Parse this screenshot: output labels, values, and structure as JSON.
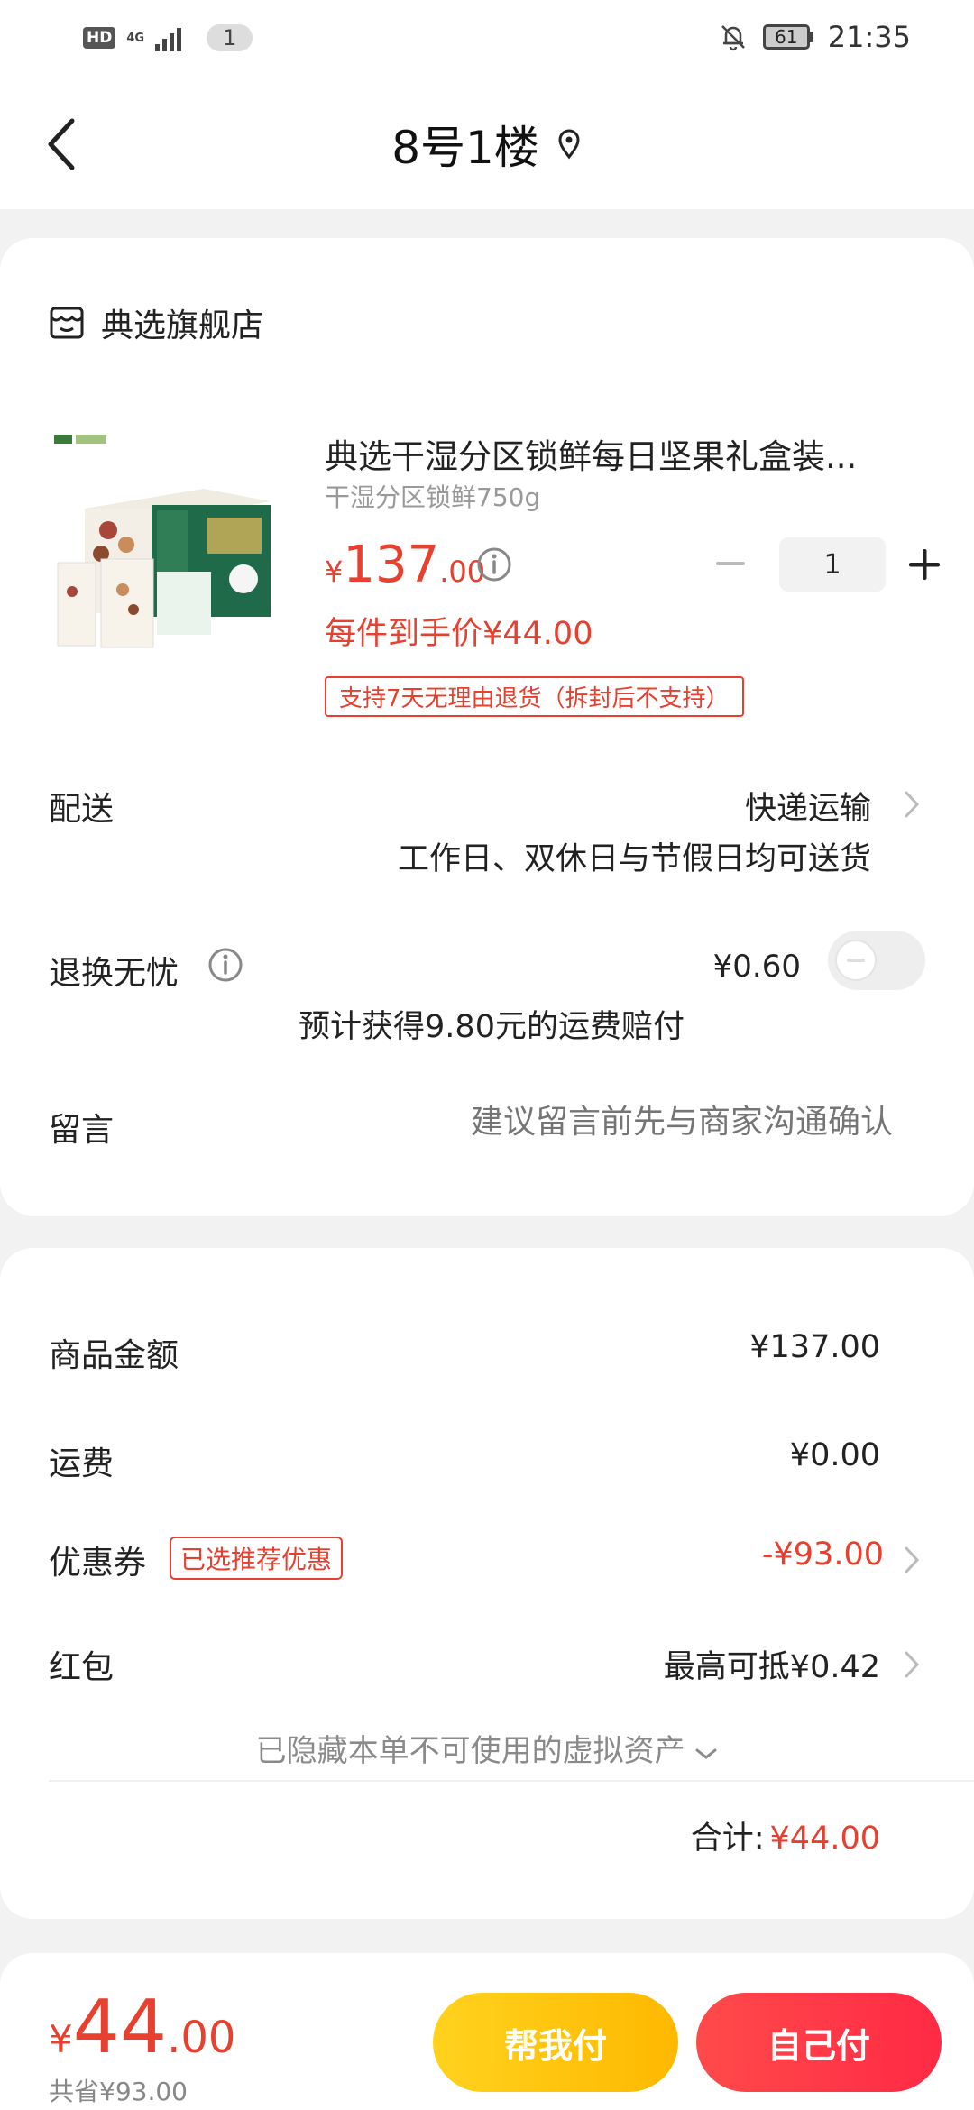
{
  "status_bar": {
    "hd": "HD",
    "network": "4G",
    "notification_count": "1",
    "battery": "61",
    "time": "21:35"
  },
  "header": {
    "title": "8号1楼"
  },
  "store": {
    "name": "典选旗舰店"
  },
  "product": {
    "title": "典选干湿分区锁鲜每日坚果礼盒装...",
    "spec": "干湿分区锁鲜750g",
    "price_symbol": "¥",
    "price_int": "137",
    "price_dec": ".00",
    "quantity": "1",
    "unit_price": "每件到手价¥44.00",
    "return_policy": "支持7天无理由退货（拆封后不支持）"
  },
  "delivery": {
    "label": "配送",
    "value": "快递运输",
    "note": "工作日、双休日与节假日均可送货"
  },
  "exchange": {
    "label": "退换无忧",
    "price": "¥0.60",
    "enabled": false,
    "note": "预计获得9.80元的运费赔付"
  },
  "remark": {
    "label": "留言",
    "placeholder": "建议留言前先与商家沟通确认"
  },
  "summary": {
    "goods_label": "商品金额",
    "goods_value": "¥137.00",
    "shipping_label": "运费",
    "shipping_value": "¥0.00",
    "coupon_label": "优惠券",
    "coupon_tag": "已选推荐优惠",
    "coupon_value": "-¥93.00",
    "redpacket_label": "红包",
    "redpacket_value": "最高可抵¥0.42",
    "hidden_assets": "已隐藏本单不可使用的虚拟资产",
    "total_label": "合计:",
    "total_value": "¥44.00"
  },
  "pay_bar": {
    "symbol": "¥",
    "amount_int": "44",
    "amount_dec": ".00",
    "saved": "共省¥93.00",
    "help_pay": "帮我付",
    "self_pay": "自己付"
  },
  "colors": {
    "accent_red": "#e8402f",
    "help_yellow": "#ffc107",
    "self_red": "#ff3347"
  }
}
